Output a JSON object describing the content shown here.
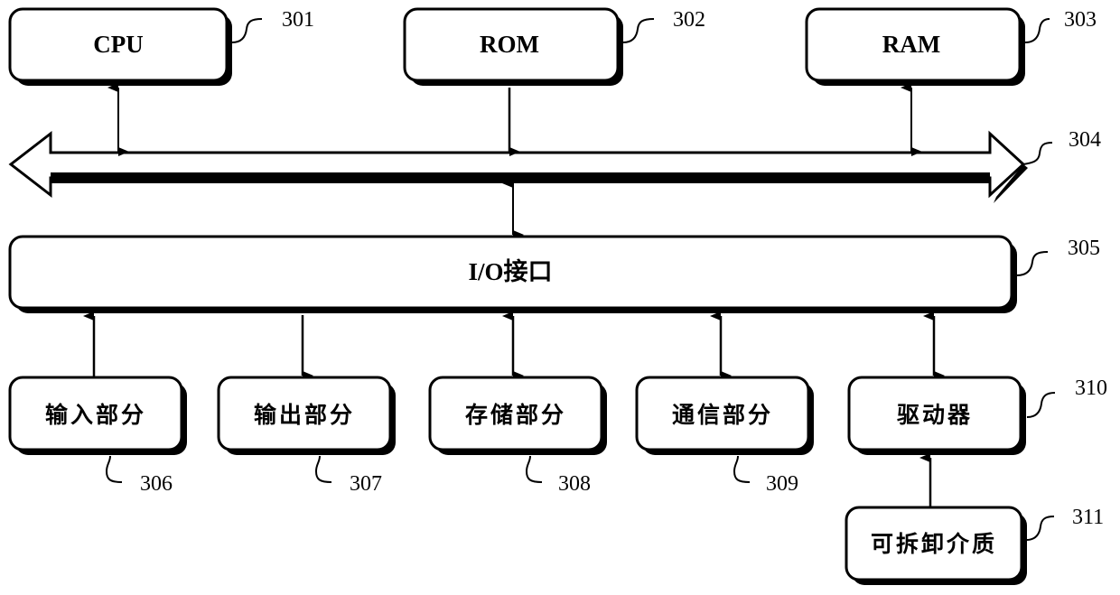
{
  "diagram": {
    "type": "hardware block diagram",
    "nodes": {
      "cpu": {
        "label": "CPU",
        "ref": "301"
      },
      "rom": {
        "label": "ROM",
        "ref": "302"
      },
      "ram": {
        "label": "RAM",
        "ref": "303"
      },
      "bus": {
        "label": "",
        "ref": "304"
      },
      "io": {
        "label": "I/O接口",
        "ref": "305"
      },
      "input": {
        "label": "输入部分",
        "ref": "306"
      },
      "output": {
        "label": "输出部分",
        "ref": "307"
      },
      "storage": {
        "label": "存储部分",
        "ref": "308"
      },
      "comm": {
        "label": "通信部分",
        "ref": "309"
      },
      "driver": {
        "label": "驱动器",
        "ref": "310"
      },
      "media": {
        "label": "可拆卸介质",
        "ref": "311"
      }
    },
    "edges": [
      {
        "from": "cpu",
        "to": "bus",
        "direction": "bidirectional"
      },
      {
        "from": "rom",
        "to": "bus",
        "direction": "one-way"
      },
      {
        "from": "ram",
        "to": "bus",
        "direction": "bidirectional"
      },
      {
        "from": "bus",
        "to": "io",
        "direction": "bidirectional"
      },
      {
        "from": "input",
        "to": "io",
        "direction": "one-way"
      },
      {
        "from": "io",
        "to": "output",
        "direction": "one-way"
      },
      {
        "from": "io",
        "to": "storage",
        "direction": "bidirectional"
      },
      {
        "from": "io",
        "to": "comm",
        "direction": "bidirectional"
      },
      {
        "from": "io",
        "to": "driver",
        "direction": "bidirectional"
      },
      {
        "from": "media",
        "to": "driver",
        "direction": "one-way"
      }
    ]
  }
}
